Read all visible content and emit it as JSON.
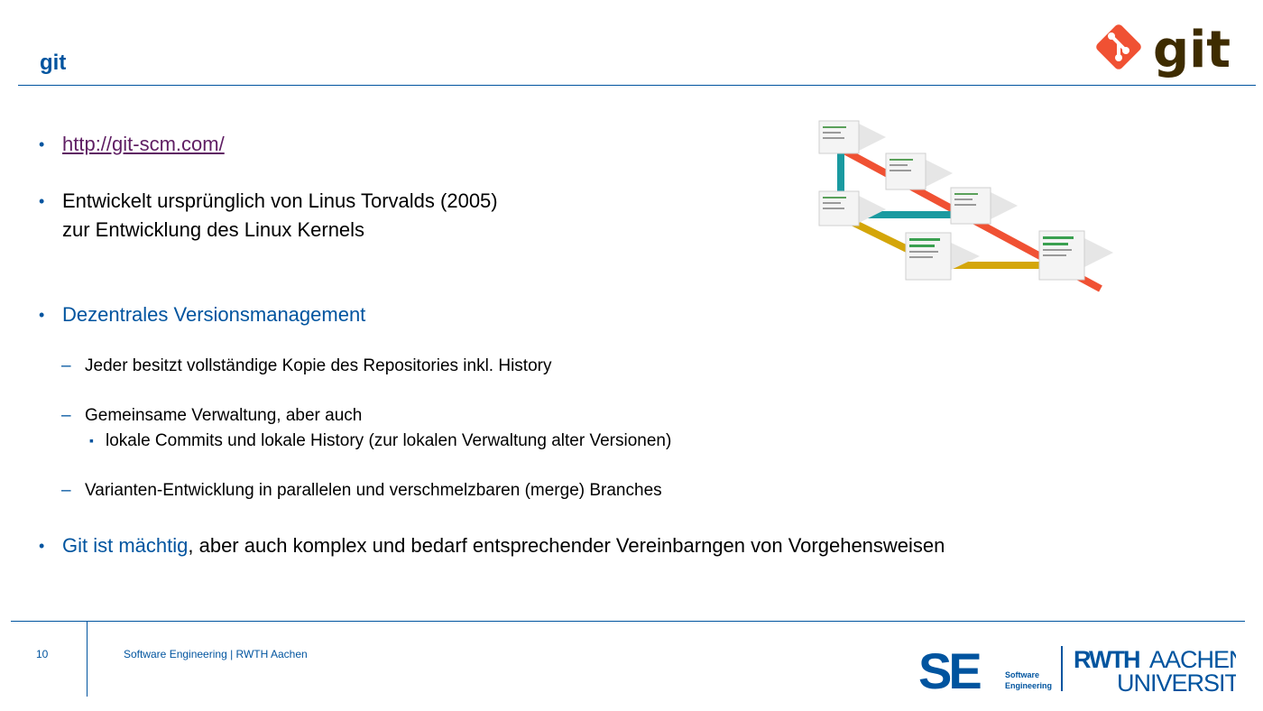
{
  "slide": {
    "title": "git",
    "logo_text": "git",
    "brand_color": "#f05133",
    "accent_color": "#00549f"
  },
  "content": {
    "link": "http://git-scm.com/",
    "point2_line1": "Entwickelt ursprünglich von Linus Torvalds (2005)",
    "point2_line2": "zur Entwicklung des Linux Kernels",
    "point3": "Dezentrales Versionsmanagement",
    "sub1": "Jeder besitzt vollständige Kopie des Repositories inkl. History",
    "sub2": "Gemeinsame Verwaltung, aber auch",
    "subsub1": "lokale Commits und lokale History (zur lokalen Verwaltung alter Versionen)",
    "sub3": "Varianten-Entwicklung in parallelen und verschmelzbaren (merge) Branches",
    "point4_highlight": "Git ist mächtig",
    "point4_rest": ", aber auch komplex und bedarf entsprechender Vereinbarngen von Vorgehensweisen"
  },
  "footer": {
    "page_number": "10",
    "text": "Software Engineering  |  RWTH Aachen",
    "se_logo": {
      "letters": "SE",
      "line1": "Software",
      "line2": "Engineering"
    },
    "rwth_logo": {
      "bold": "RWTH",
      "light": "AACHEN",
      "line2": "UNIVERSITY"
    }
  }
}
